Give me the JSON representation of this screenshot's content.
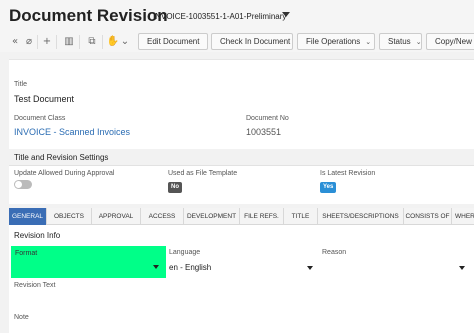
{
  "header": {
    "title": "Document Revision",
    "doc_id": "INVOICE-1003551-1-A01-Preliminary"
  },
  "toolbar": {
    "icons": [
      "collapse-icon",
      "attach-icon",
      "add-icon",
      "delete-icon",
      "copy-icon",
      "hand-icon"
    ],
    "edit_document": "Edit Document",
    "check_in_document": "Check In Document",
    "file_operations": "File Operations",
    "status": "Status",
    "copy_new": "Copy/New"
  },
  "details": {
    "title_label": "Title",
    "title_value": "Test Document",
    "document_class_label": "Document Class",
    "document_class_value": "INVOICE - Scanned Invoices",
    "document_no_label": "Document No",
    "document_no_value": "1003551"
  },
  "settings": {
    "section_title": "Title and Revision Settings",
    "update_allowed_label": "Update Allowed During Approval",
    "update_allowed_on": false,
    "file_template_label": "Used as File Template",
    "file_template_value": "No",
    "latest_revision_label": "Is Latest Revision",
    "latest_revision_value": "Yes"
  },
  "tabs": [
    "GENERAL",
    "OBJECTS",
    "APPROVAL",
    "ACCESS",
    "DEVELOPMENT",
    "FILE REFS.",
    "TITLE",
    "SHEETS/DESCRIPTIONS",
    "CONSISTS OF",
    "WHER"
  ],
  "active_tab": "GENERAL",
  "general": {
    "revision_info_title": "Revision Info",
    "format_label": "Format",
    "language_label": "Language",
    "language_value": "en - English",
    "reason_label": "Reason",
    "revision_text_label": "Revision Text",
    "note_label": "Note"
  },
  "colors": {
    "accent": "#3a6db5",
    "link": "#2a6cb3",
    "highlight": "#00ff88",
    "no_badge": "#555555",
    "yes_badge": "#2b8fd6"
  }
}
